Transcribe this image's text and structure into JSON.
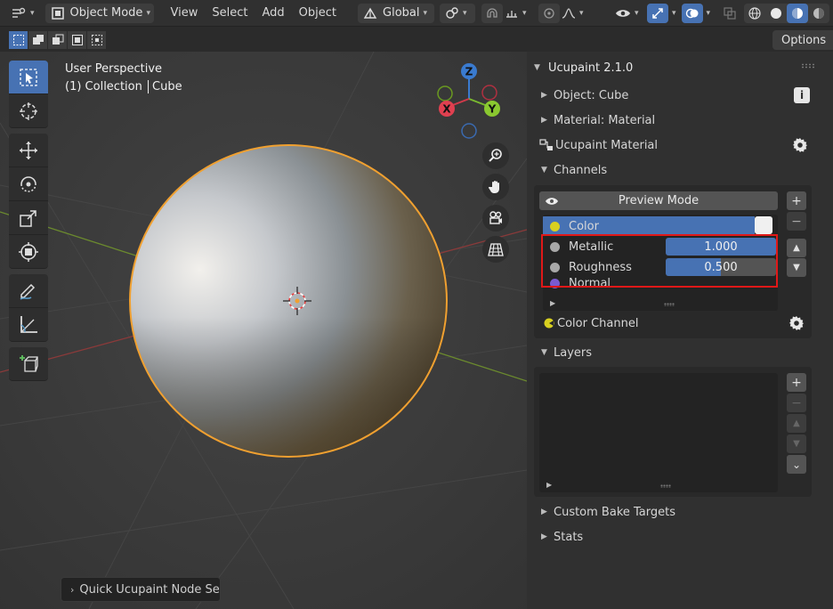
{
  "header": {
    "mode": "Object Mode",
    "menus": [
      "View",
      "Select",
      "Add",
      "Object"
    ],
    "orientation": "Global"
  },
  "toolbar2": {
    "options_label": "Options"
  },
  "viewport": {
    "view_name": "User Perspective",
    "collection": "(1) Collection",
    "object": "Cube",
    "axes": {
      "z": "Z",
      "x": "X",
      "y": "Y"
    },
    "quick_op": "Quick Ucupaint Node Setu"
  },
  "sidebar": {
    "title": "Ucupaint 2.1.0",
    "object_row": "Object: Cube",
    "material_row": "Material: Material",
    "ucupaint_material": "Ucupaint Material",
    "channels_label": "Channels",
    "preview_mode": "Preview Mode",
    "channels": [
      {
        "name": "Color",
        "color": "#d8d020",
        "value": ""
      },
      {
        "name": "Metallic",
        "color": "#a8a8a8",
        "value": "1.000",
        "fill": 1.0
      },
      {
        "name": "Roughness",
        "color": "#a8a8a8",
        "value": "0.500",
        "fill": 0.5
      },
      {
        "name": "Normal",
        "color": "#7a5ad0",
        "value": ""
      }
    ],
    "color_channel": "Color Channel",
    "layers_label": "Layers",
    "custom_bake": "Custom Bake Targets",
    "stats": "Stats"
  },
  "colors": {
    "accent": "#4772b3",
    "highlight": "#e01818",
    "selection_outline": "#f0a030"
  }
}
